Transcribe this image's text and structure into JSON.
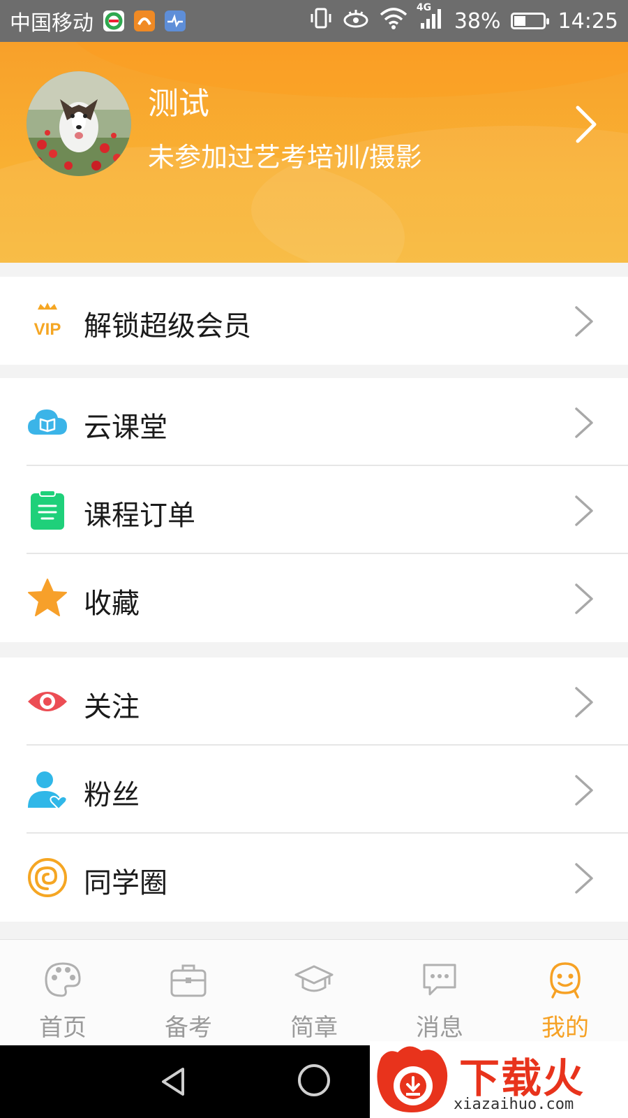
{
  "status_bar": {
    "carrier": "中国移动",
    "network": "4G",
    "battery": "38%",
    "battery_level": 0.38,
    "time": "14:25"
  },
  "profile": {
    "name": "测试",
    "subtitle": "未参加过艺考培训/摄影"
  },
  "menu": {
    "vip": {
      "label": "解锁超级会员",
      "icon": "vip-crown-icon"
    },
    "cloud": {
      "label": "云课堂",
      "icon": "cloud-book-icon"
    },
    "orders": {
      "label": "课程订单",
      "icon": "clipboard-icon"
    },
    "favorites": {
      "label": "收藏",
      "icon": "star-icon"
    },
    "follow": {
      "label": "关注",
      "icon": "eye-icon"
    },
    "fans": {
      "label": "粉丝",
      "icon": "user-heart-icon"
    },
    "classmates": {
      "label": "同学圈",
      "icon": "spiral-icon"
    }
  },
  "tabs": [
    {
      "label": "首页",
      "icon": "palette-icon"
    },
    {
      "label": "备考",
      "icon": "briefcase-icon"
    },
    {
      "label": "简章",
      "icon": "graduation-cap-icon"
    },
    {
      "label": "消息",
      "icon": "chat-bubble-icon"
    },
    {
      "label": "我的",
      "icon": "smiley-icon",
      "active": true
    }
  ],
  "watermark": {
    "brand": "下载火",
    "url": "xiazaihuo.com"
  },
  "colors": {
    "accent": "#f6a124",
    "header_gradient_top": "#f8a02a",
    "vip": "#f5a623",
    "cloud": "#3bb4e8",
    "orders": "#1fd07a",
    "star": "#f7a02a",
    "eye": "#ec4d54",
    "fans": "#30b7e8",
    "spiral": "#f5a623"
  }
}
